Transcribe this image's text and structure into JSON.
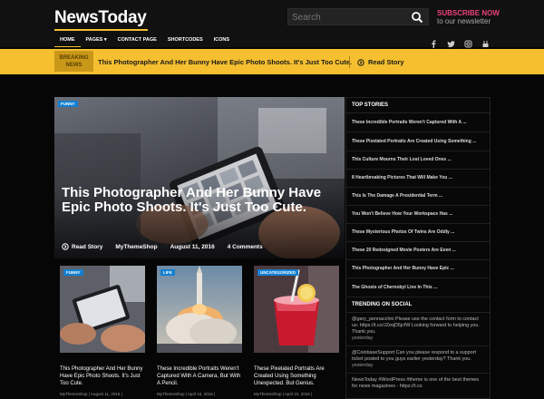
{
  "site": {
    "logo": "NewsToday"
  },
  "search": {
    "placeholder": "Search"
  },
  "subscribe": {
    "line1": "SUBSCRIBE NOW",
    "line2": "to our newsletter"
  },
  "nav": {
    "items": [
      "HOME",
      "PAGES ▾",
      "CONTACT PAGE",
      "SHORTCODES",
      "ICONS"
    ]
  },
  "social_icons": [
    "facebook-icon",
    "twitter-icon",
    "instagram-icon",
    "youtube-icon"
  ],
  "ticker": {
    "label_line1": "BREAKING",
    "label_line2": "NEWS",
    "headline": "This Photographer And Her Bunny Have Epic Photo Shoots. It's Just Too Cute.",
    "read": "Read Story"
  },
  "hero": {
    "tag": "FUNNY",
    "title": "This Photographer And Her Bunny Have Epic Photo Shoots. It's Just Too Cute.",
    "read": "Read Story",
    "author": "MyThemeShop",
    "date": "August 11, 2016",
    "comments": "4 Comments"
  },
  "cards": [
    {
      "tag": "FUNNY",
      "title": "This Photographer And Her Bunny Have Epic Photo Shoots. It's Just Too Cute.",
      "meta": "MyThemeShop | August 11, 2016 |"
    },
    {
      "tag": "LIFE",
      "title": "These Incredible Portraits Weren't Captured With A Camera, But With A Pencil.",
      "meta": "MyThemeShop | April 10, 2016 |"
    },
    {
      "tag": "UNCATEGORIZED",
      "title": "These Pixelated Portraits Are Created Using Something Unexpected. But Genius.",
      "meta": "MyThemeShop | April 10, 2016 |"
    }
  ],
  "sidebar": {
    "top_title": "TOP STORIES",
    "top_stories": [
      "These Incredible Portraits Weren't Captured With A ...",
      "These Pixelated Portraits Are Created Using Something ...",
      "This Culture Mourns Their Lost Loved Ones ...",
      "8 Heartbreaking Pictures That Will Make You ...",
      "This Is The Damage A Presidential Term ...",
      "You Won't Believe How Your Workspace Has ...",
      "These Mysterious Photos Of Twins Are Oddly ...",
      "These 20 Redesigned Movie Posters Are Even ...",
      "This Photographer And Her Bunny Have Epic ...",
      "The Ghosts of Chernobyl Live In This ..."
    ],
    "social_title": "TRENDING ON SOCIAL",
    "tweets": [
      {
        "text": "@gary_pennacchio Please use the contact form to contact us: https://t.co/JZeqD5jcfW Looking forward to helping you. Thank you.",
        "time": "yesterday"
      },
      {
        "text": "@CoinbaseSupport Can you please respond to a support ticket posted to you guys earlier yesterday? Thank you.",
        "time": "yesterday"
      },
      {
        "text": "NewsToday #WordPress #theme is one of the best themes for news magazines - https://t.co",
        "time": ""
      }
    ]
  },
  "colors": {
    "accent": "#f5bf2f",
    "tag": "#1480d1",
    "subscribe": "#e8417c",
    "background": "#060606"
  }
}
